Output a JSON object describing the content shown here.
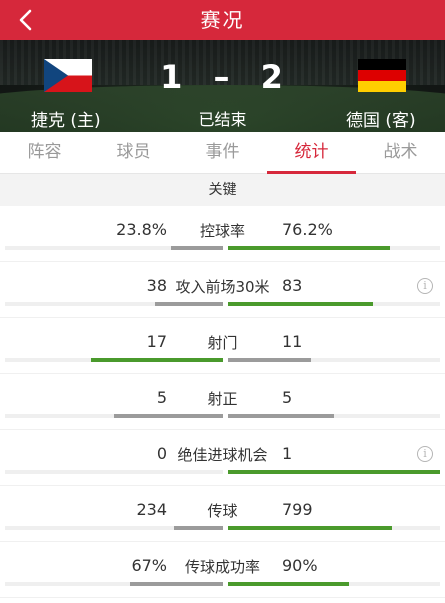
{
  "header": {
    "title": "赛况"
  },
  "match": {
    "home_team": "捷克 (主)",
    "away_team": "德国 (客)",
    "home_score": "1",
    "separator": "–",
    "away_score": "2",
    "status": "已结束"
  },
  "tabs": [
    "阵容",
    "球员",
    "事件",
    "统计",
    "战术"
  ],
  "active_tab": "统计",
  "section": {
    "title": "关键"
  },
  "colors": {
    "brand": "#d6283b",
    "leader_bar": "#4a9a2c",
    "trailer_bar": "#9b9b9b"
  },
  "stats": [
    {
      "label": "控球率",
      "home": "23.8%",
      "away": "76.2%",
      "home_frac": 0.238,
      "away_frac": 0.762,
      "leader": "away",
      "info": false
    },
    {
      "label": "攻入前场30米",
      "home": "38",
      "away": "83",
      "home_frac": 0.314,
      "away_frac": 0.686,
      "leader": "away",
      "info": true
    },
    {
      "label": "射门",
      "home": "17",
      "away": "11",
      "home_frac": 0.607,
      "away_frac": 0.393,
      "leader": "home",
      "info": false
    },
    {
      "label": "射正",
      "home": "5",
      "away": "5",
      "home_frac": 0.5,
      "away_frac": 0.5,
      "leader": "none",
      "info": false
    },
    {
      "label": "绝佳进球机会",
      "home": "0",
      "away": "1",
      "home_frac": 0.0,
      "away_frac": 1.0,
      "leader": "away",
      "info": true
    },
    {
      "label": "传球",
      "home": "234",
      "away": "799",
      "home_frac": 0.227,
      "away_frac": 0.773,
      "leader": "away",
      "info": false
    },
    {
      "label": "传球成功率",
      "home": "67%",
      "away": "90%",
      "home_frac": 0.427,
      "away_frac": 0.573,
      "leader": "away",
      "info": false
    }
  ]
}
